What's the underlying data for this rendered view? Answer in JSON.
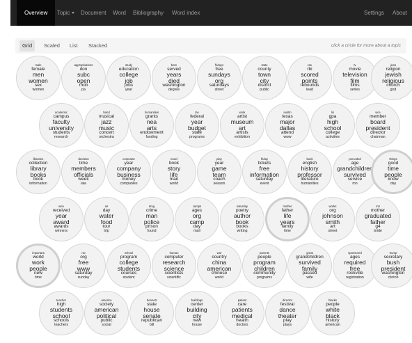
{
  "nav": {
    "items": [
      {
        "label": "Overview",
        "active": true
      },
      {
        "label": "Topic",
        "dropdown": true
      },
      {
        "label": "Document"
      },
      {
        "label": "Word"
      },
      {
        "label": "Bibliography"
      },
      {
        "label": "Word index"
      }
    ],
    "right": [
      {
        "label": "Settings"
      },
      {
        "label": "About"
      }
    ]
  },
  "tabs": {
    "items": [
      {
        "label": "Grid",
        "active": true
      },
      {
        "label": "Scaled"
      },
      {
        "label": "List"
      },
      {
        "label": "Stacked"
      }
    ],
    "hint": "click a circle for more about a topic"
  },
  "topics": [
    [
      "male",
      "female",
      "men",
      "women",
      "sex",
      "women"
    ],
    [
      "appropriations",
      "don",
      "subc",
      "open",
      "rhob",
      "pa"
    ],
    [
      "study",
      "education",
      "college",
      "job",
      "jobs",
      "year"
    ],
    [
      "born",
      "served",
      "years",
      "died",
      "washington",
      "degree"
    ],
    [
      "fridays",
      "free",
      "sundays",
      "org",
      "saturdays",
      "street"
    ],
    [
      "state",
      "county",
      "town",
      "city",
      "district",
      "public"
    ],
    [
      "vse",
      "rbi",
      "scored",
      "points",
      "rebounds",
      "lead"
    ],
    [
      "tv",
      "movie",
      "television",
      "film",
      "films",
      "series"
    ],
    [
      "jews",
      "religion",
      "jewish",
      "religious",
      "church",
      "god"
    ],
    [
      "academic",
      "campus",
      "faculty",
      "university",
      "students",
      "research"
    ],
    [
      "band",
      "musical",
      "jazz",
      "music",
      "concert",
      "orchestra"
    ],
    [
      "humanities",
      "grants",
      "nea",
      "arts",
      "endowment",
      "funding"
    ],
    [
      "tax",
      "federal",
      "year",
      "budget",
      "state",
      "programs"
    ],
    [
      "work",
      "artist",
      "museum",
      "art",
      "artists",
      "exhibition"
    ],
    [
      "austin",
      "texas",
      "major",
      "dallas",
      "attend",
      "www"
    ],
    [
      "lis",
      "gpa",
      "high",
      "school",
      "college",
      "activities"
    ],
    [
      "vice",
      "member",
      "board",
      "president",
      "director",
      "chairman"
    ],
    [
      "libraries",
      "collection",
      "library",
      "books",
      "book",
      "information"
    ],
    [
      "decision",
      "time",
      "members",
      "officials",
      "week",
      "law"
    ],
    [
      "corporate",
      "year",
      "company",
      "business",
      "money",
      "companies"
    ],
    [
      "novel",
      "book",
      "story",
      "life",
      "man",
      "world"
    ],
    [
      "play",
      "year",
      "game",
      "team",
      "coach",
      "season"
    ],
    [
      "friday",
      "tickets",
      "free",
      "information",
      "saturday",
      "event"
    ],
    [
      "book",
      "english",
      "history",
      "professor",
      "literature",
      "humanities"
    ],
    [
      "preceded",
      "age",
      "grandchildren",
      "survived",
      "service",
      "mn"
    ],
    [
      "things",
      "good",
      "time",
      "people",
      "know",
      "day"
    ],
    [
      "won",
      "received",
      "year",
      "award",
      "awards",
      "winners"
    ],
    [
      "air",
      "day",
      "water",
      "food",
      "tour",
      "trip"
    ],
    [
      "drug",
      "crime",
      "man",
      "police",
      "prison",
      "found"
    ],
    [
      "camps",
      "ages",
      "org",
      "camp",
      "day",
      "mail"
    ],
    [
      "saturday",
      "poetry",
      "author",
      "book",
      "books",
      "writing"
    ],
    [
      "mother",
      "father",
      "life",
      "years",
      "family",
      "time"
    ],
    [
      "works",
      "org",
      "johnson",
      "smith",
      "art",
      "street"
    ],
    [
      "m2",
      "mother",
      "graduated",
      "father",
      "g4",
      "bride"
    ],
    [
      "important",
      "world",
      "work",
      "people",
      "new",
      "time"
    ],
    [
      "nw",
      "org",
      "free",
      "www",
      "saturday",
      "sunday"
    ],
    [
      "school",
      "program",
      "college",
      "students",
      "courses",
      "student"
    ],
    [
      "human",
      "computer",
      "research",
      "science",
      "scientists",
      "scientific"
    ],
    [
      "war",
      "country",
      "china",
      "american",
      "chinese",
      "world"
    ],
    [
      "parents",
      "people",
      "program",
      "children",
      "community",
      "programs"
    ],
    [
      "great",
      "grandchildren",
      "survived",
      "family",
      "passed",
      "wife"
    ],
    [
      "sponsored",
      "ages",
      "required",
      "free",
      "rockville",
      "registration"
    ],
    [
      "trump",
      "secretary",
      "bush",
      "president",
      "washington",
      "clinton"
    ],
    [
      "teacher",
      "high",
      "students",
      "school",
      "schools",
      "teachers"
    ],
    [
      "america",
      "society",
      "american",
      "political",
      "public",
      "social"
    ],
    [
      "bennett",
      "state",
      "house",
      "senate",
      "republican",
      "bill"
    ],
    [
      "buildings",
      "center",
      "building",
      "city",
      "new",
      "house"
    ],
    [
      "patient",
      "care",
      "patients",
      "medical",
      "health",
      "doctors"
    ],
    [
      "director",
      "festival",
      "dance",
      "theater",
      "play",
      "plays"
    ],
    [
      "blacks",
      "people",
      "white",
      "black",
      "history",
      "american"
    ]
  ],
  "highlighted": [
    25,
    31,
    34
  ]
}
